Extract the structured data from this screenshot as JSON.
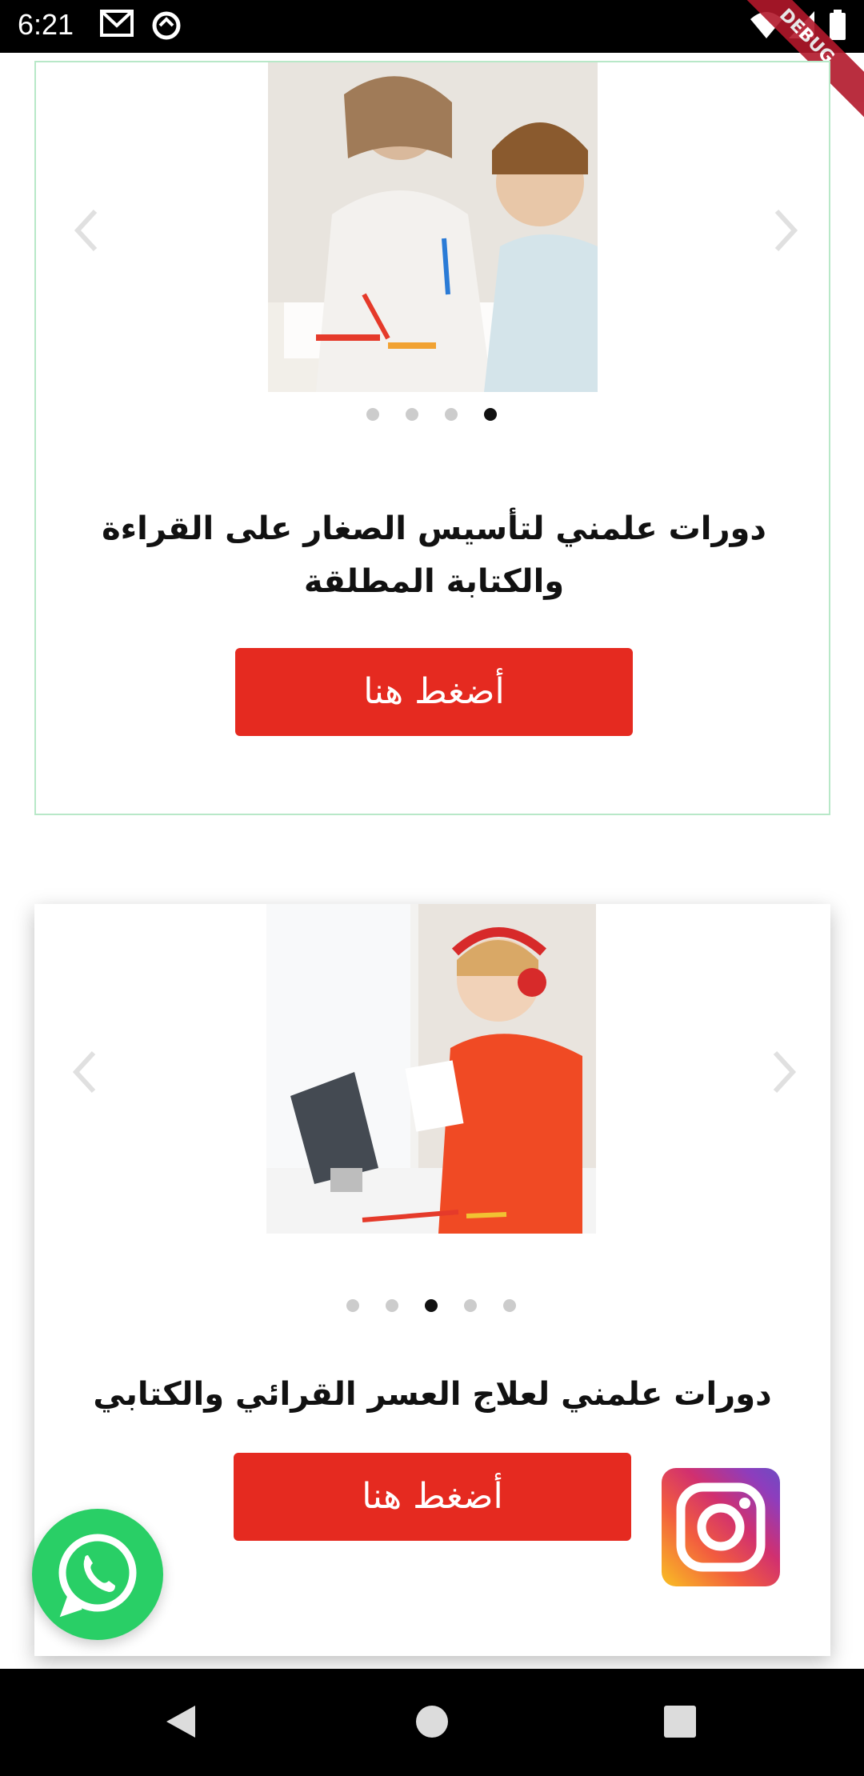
{
  "status_bar": {
    "time": "6:21",
    "icons": [
      "gmail-icon",
      "sync-icon",
      "wifi-icon",
      "signal-icon",
      "battery-icon"
    ],
    "debug_label": "DEBUG"
  },
  "cards": [
    {
      "image": "teacher-and-child-writing",
      "dots_count": 4,
      "active_dot": 4,
      "title": "دورات علمني لتأسيس الصغار على القراءة والكتابة المطلقة",
      "button_label": "أضغط هنا"
    },
    {
      "image": "child-with-headphones-tablet",
      "dots_count": 5,
      "active_dot": 3,
      "title": "دورات علمني لعلاج العسر القرائي والكتابي",
      "button_label": "أضغط هنا"
    }
  ],
  "colors": {
    "accent_red": "#e52a20",
    "whatsapp_green": "#29cf66",
    "card_border": "#b8e8c8"
  },
  "floating": {
    "whatsapp": "whatsapp-icon",
    "instagram": "instagram-icon"
  },
  "nav_bar": {
    "buttons": [
      "back-icon",
      "home-icon",
      "recents-icon"
    ]
  }
}
